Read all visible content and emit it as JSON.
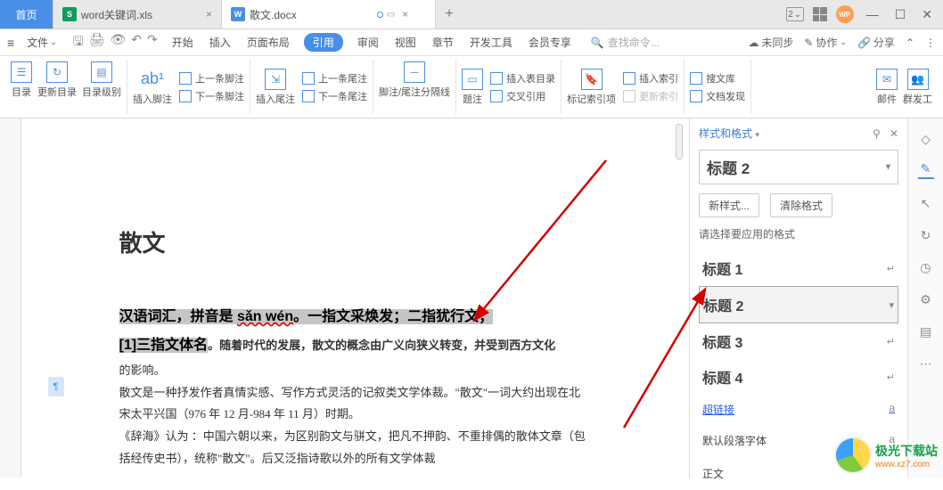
{
  "titlebar": {
    "home": "首页",
    "tab_excel": "word关键词.xls",
    "tab_doc": "散文.docx",
    "badge": "2",
    "avatar": "WP"
  },
  "menu": {
    "file": "文件",
    "items": [
      "开始",
      "插入",
      "页面布局",
      "引用",
      "审阅",
      "视图",
      "章节",
      "开发工具",
      "会员专享"
    ],
    "search_placeholder": "查找命令...",
    "right": {
      "unsync": "未同步",
      "collab": "协作",
      "share": "分享"
    }
  },
  "ribbon": {
    "toc": "目录",
    "update_toc": "更新目录",
    "toc_level": "目录级别",
    "insert_footnote": "插入脚注",
    "prev_footnote": "上一条脚注",
    "next_footnote": "下一条脚注",
    "insert_endnote": "插入尾注",
    "prev_endnote": "上一条尾注",
    "next_endnote": "下一条尾注",
    "separator": "脚注/尾注分隔线",
    "caption": "题注",
    "cross_ref": "交叉引用",
    "insert_toc2": "插入表目录",
    "mark_index": "标记索引项",
    "insert_index": "插入索引",
    "update_index": "更新索引",
    "search_lib": "搜文库",
    "doc_discover": "文档发现",
    "mail": "邮件",
    "mass_send": "群发工"
  },
  "document": {
    "title": "散文",
    "sel_line1_a": "汉语词汇，拼音是 ",
    "sel_line1_pinyin": "sǎn wén",
    "sel_line1_b": "。一指文采焕发；二指犹行文；",
    "sel_line2_a": "[1]三指文体名",
    "body_after_sel": "。随着时代的发展，散文的概念由广义向狭义转变，并受到西方文化",
    "body_line2": "的影响。",
    "body_p2": "散文是一种抒发作者真情实感、写作方式灵活的记叙类文学体裁。\"散文\"一词大约出现在北宋太平兴国（976 年 12 月-984 年 11 月）时期。",
    "body_p3": "《辞海》认为 ：中国六朝以来，为区别韵文与骈文，把凡不押韵、不重排偶的散体文章（包括经传史书），统称\"散文\"。后又泛指诗歌以外的所有文学体裁"
  },
  "panel": {
    "title": "样式和格式",
    "current": "标题 2",
    "new_style": "新样式...",
    "clear": "清除格式",
    "apply_hint": "请选择要应用的格式",
    "styles": [
      {
        "name": "标题 1"
      },
      {
        "name": "标题 2"
      },
      {
        "name": "标题 3"
      },
      {
        "name": "标题 4"
      }
    ],
    "hyperlink": "超链接",
    "default_font": "默认段落字体",
    "body_text": "正文"
  },
  "watermark": {
    "line1": "极光下载站",
    "line2": "www.xz7.com"
  }
}
